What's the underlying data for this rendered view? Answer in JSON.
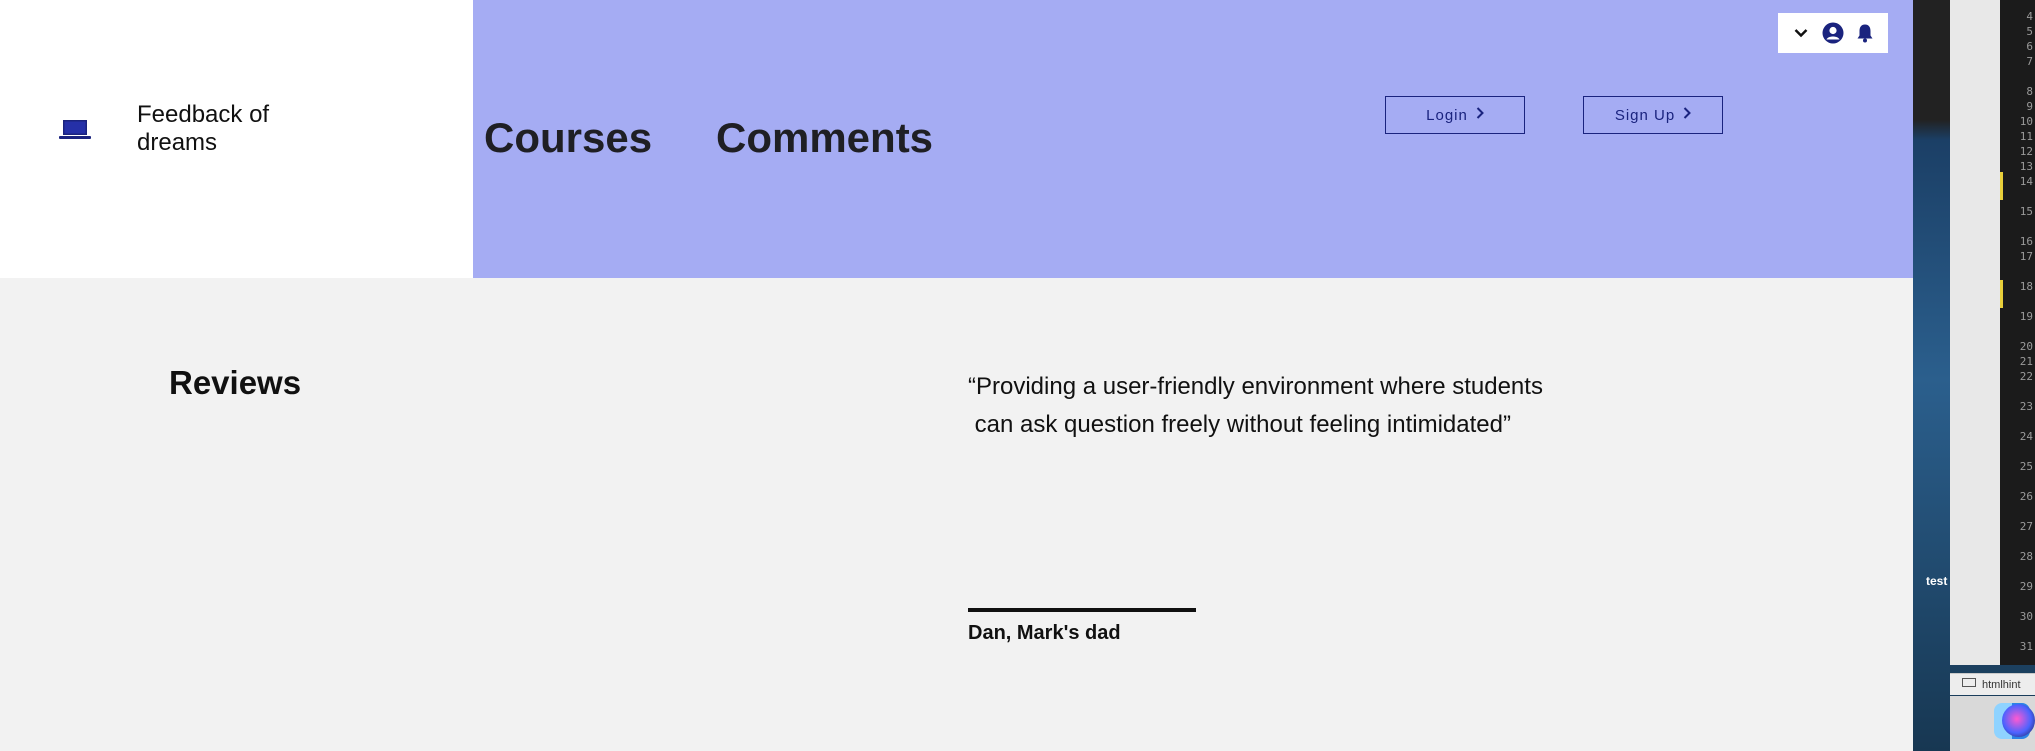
{
  "brand": {
    "name": "Feedback of dreams",
    "icon": "laptop-icon"
  },
  "nav": {
    "courses": "Courses",
    "comments": "Comments"
  },
  "auth": {
    "login_label": "Login",
    "signup_label": "Sign Up"
  },
  "toolbar_icons": [
    "chevron-down-icon",
    "user-avatar-icon",
    "bell-icon"
  ],
  "reviews": {
    "title": "Reviews",
    "quote_line1": "“Providing a user-friendly environment where students",
    "quote_line2": " can ask question freely without feeling intimidated”",
    "author": "Dan, Mark's dad"
  },
  "desktop": {
    "label": "test",
    "taskbar_label": "htmlhint",
    "line_numbers": [
      "4",
      "5",
      "6",
      "7",
      "8",
      "9",
      "10",
      "11",
      "12",
      "13",
      "14",
      "15",
      "16",
      "17",
      "18",
      "19",
      "20",
      "21",
      "22",
      "23",
      "24",
      "25",
      "26",
      "27",
      "28",
      "29",
      "30",
      "31"
    ]
  },
  "colors": {
    "header_bg": "#a5acf3",
    "accent": "#1a237e",
    "page_bg": "#f2f2f2"
  }
}
